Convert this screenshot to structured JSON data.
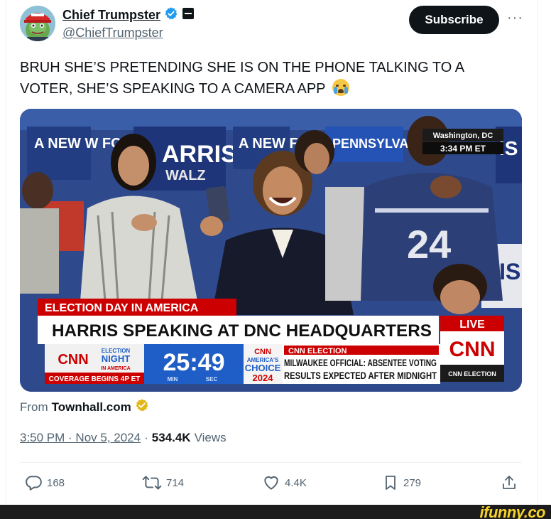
{
  "author": {
    "display_name": "Chief Trumpster",
    "handle": "@ChiefTrumpster"
  },
  "subscribe_label": "Subscribe",
  "more_label": "···",
  "tweet": {
    "text": "BRUH SHE’S PRETENDING SHE IS ON THE PHONE TALKING TO A VOTER, SHE’S SPEAKING TO A CAMERA APP"
  },
  "media": {
    "location_line1": "Washington, DC",
    "location_line2": "3:34 PM ET",
    "banner_top": "ELECTION DAY IN AMERICA",
    "headline": "HARRIS SPEAKING AT DNC HEADQUARTERS",
    "live_label": "LIVE",
    "cnn_logo": "CNN",
    "election_night_l1": "ELECTION",
    "election_night_l2": "NIGHT",
    "election_night_l3": "IN AMERICA",
    "coverage": "COVERAGE BEGINS 4P ET",
    "countdown": "25:49",
    "countdown_min": "MIN",
    "countdown_sec": "SEC",
    "choice_l1": "AMERICA'S",
    "choice_l2": "CHOICE",
    "choice_l3": "2024",
    "ticker_tag": "CNN ELECTION",
    "ticker_line1": "MILWAUKEE OFFICIAL: ABSENTEE VOTING",
    "ticker_line2": "RESULTS EXPECTED AFTER MIDNIGHT",
    "cnn_election_small": "CNN ELECTION",
    "sign_left": "A NEW W FORWA",
    "sign_harris": "ARRIS",
    "sign_walz": "WALZ",
    "sign_mid": "A NEW FO",
    "sign_penn": "PENNSYLVA",
    "sign_right": "IS",
    "jersey": "24"
  },
  "source": {
    "prefix": "From",
    "site": "Townhall.com"
  },
  "meta": {
    "time": "3:50 PM · Nov 5, 2024",
    "separator": "·",
    "views_count": "534.4K",
    "views_label": "Views"
  },
  "actions": {
    "replies": "168",
    "reposts": "714",
    "likes": "4.4K",
    "bookmarks": "279"
  },
  "watermark": "ifunny.co",
  "colors": {
    "verified_blue": "#1d9bf0",
    "verified_gold": "#e2b719",
    "cnn_red": "#cc0000",
    "cnn_blue": "#1f5ec6"
  }
}
